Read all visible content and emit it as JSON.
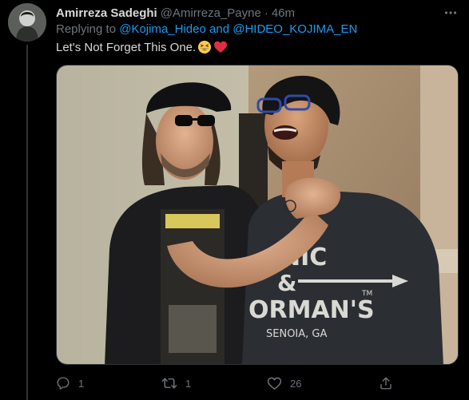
{
  "tweet": {
    "display_name": "Amirreza Sadeghi",
    "handle": "@Amirreza_Payne",
    "separator": "·",
    "time": "46m",
    "replying_prefix": "Replying to ",
    "mention_1": "@Kojima_Hideo",
    "replying_joiner": " and ",
    "mention_2": "@HIDEO_KOJIMA_EN",
    "text": "Let's Not Forget This One."
  },
  "media": {
    "shirt_text_line1": "NIC",
    "shirt_text_line2": "&",
    "shirt_text_line3": "ORMAN'S",
    "shirt_text_line4": "SENOIA, GA",
    "shirt_tm": "TM"
  },
  "actions": {
    "reply_count": "1",
    "retweet_count": "1",
    "like_count": "26"
  },
  "colors": {
    "background": "#000000",
    "text": "#d9d9d9",
    "secondary_text": "#6e767d",
    "link": "#1d9bf0",
    "divider": "#2f3336"
  },
  "icons": {
    "more": "more-icon",
    "reply": "reply-icon",
    "retweet": "retweet-icon",
    "like": "like-icon",
    "share": "share-icon",
    "emoji_1": "grinning-squinting-face-emoji",
    "emoji_2": "red-heart-emoji"
  }
}
